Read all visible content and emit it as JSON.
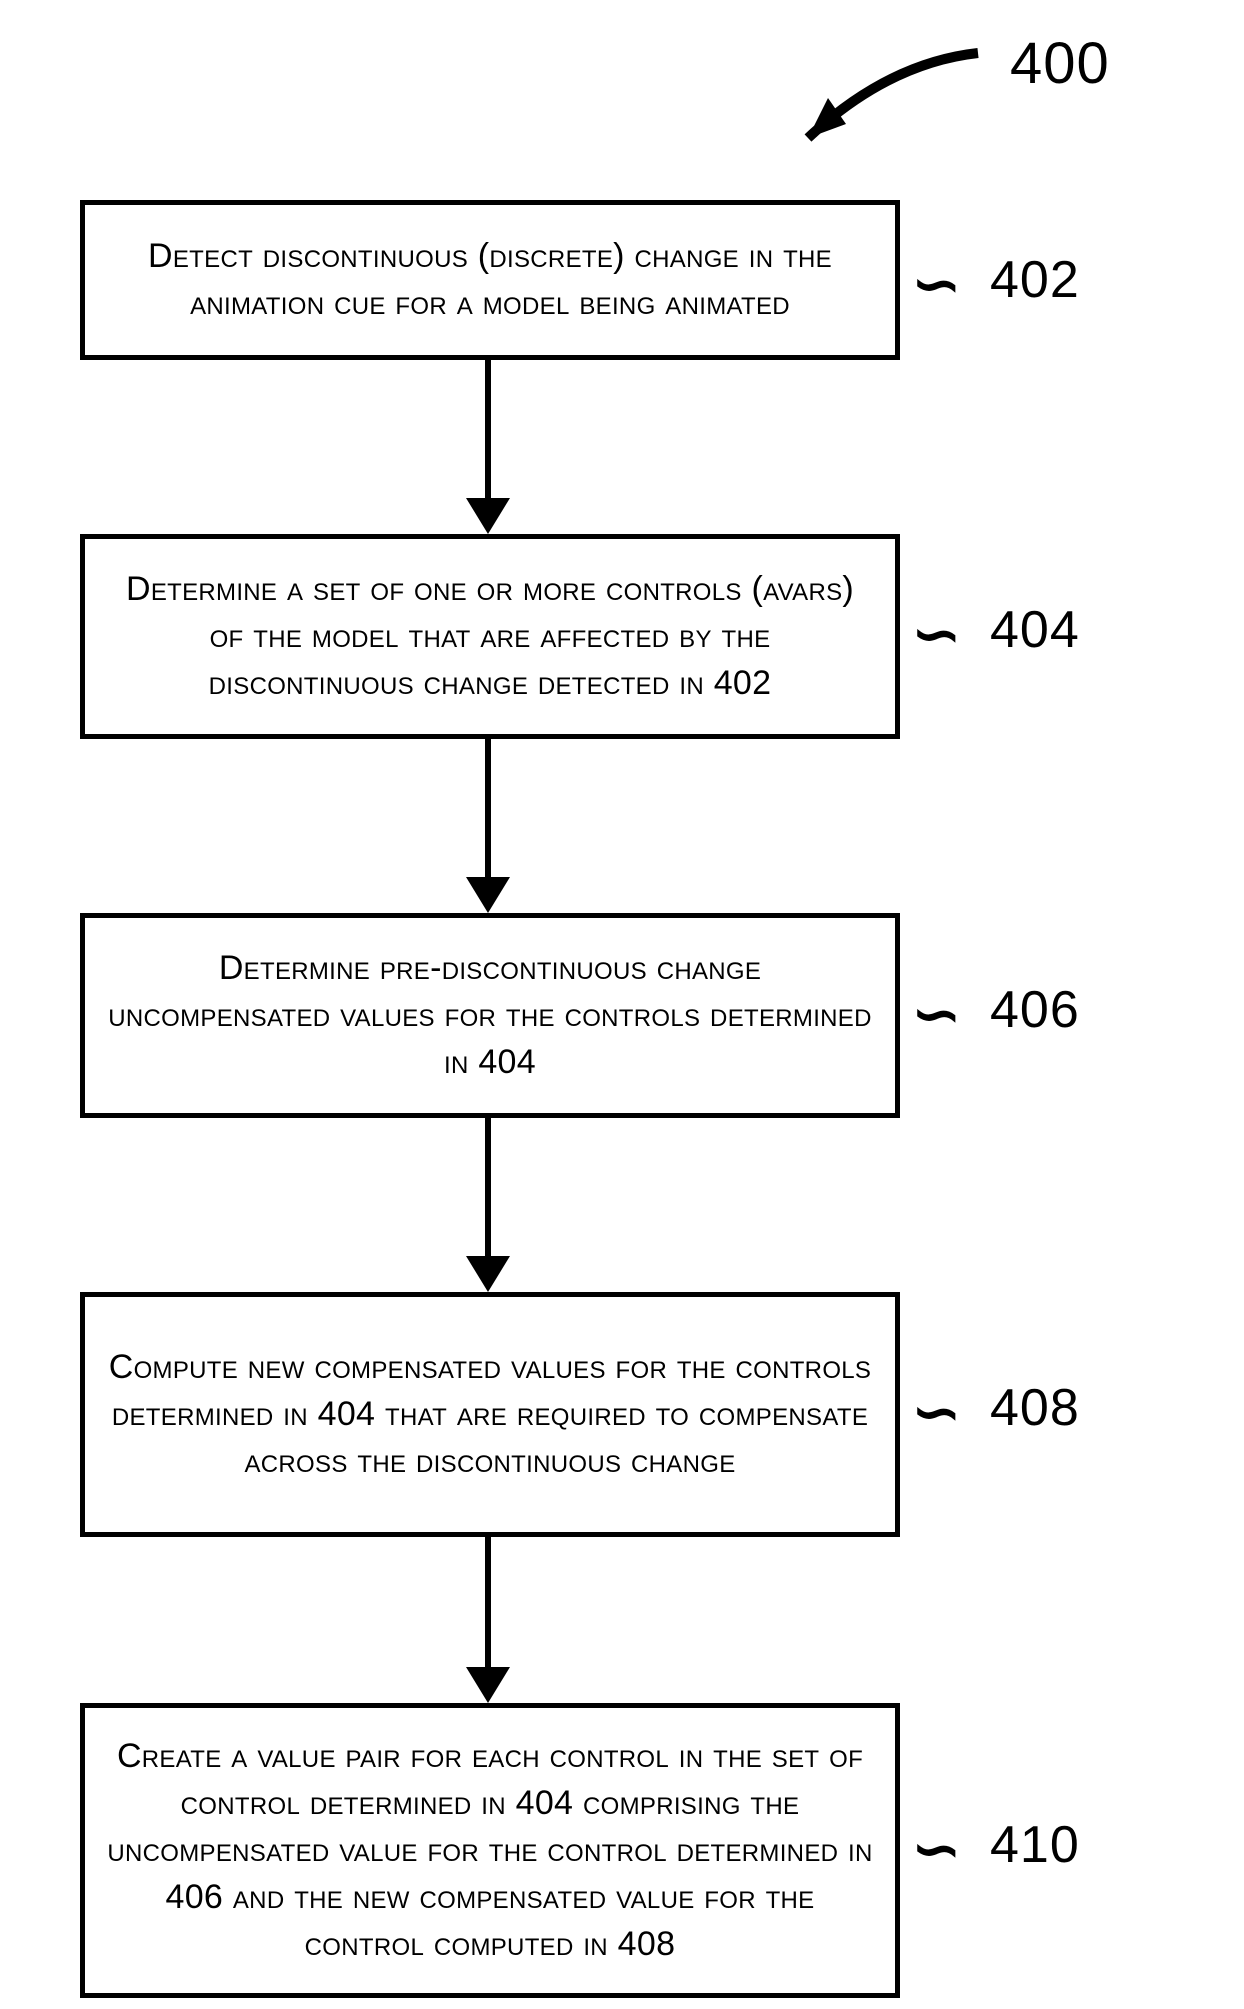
{
  "figure_label": "400",
  "steps": [
    {
      "num": "402",
      "text": "Detect discontinuous (discrete) change in the animation cue for a model being animated"
    },
    {
      "num": "404",
      "text": "Determine a set of one or more controls (avars) of the model that are affected by the discontinuous change detected in 402"
    },
    {
      "num": "406",
      "text": "Determine pre-discontinuous change uncompensated values for the controls determined in 404"
    },
    {
      "num": "408",
      "text": "Compute new compensated values for the controls determined in 404 that are required to compensate across the discontinuous change"
    },
    {
      "num": "410",
      "text": "Create a value pair for each control in the set of control determined in 404 comprising the uncompensated value for the control determined in 406 and the new compensated value for the control computed in 408"
    }
  ]
}
